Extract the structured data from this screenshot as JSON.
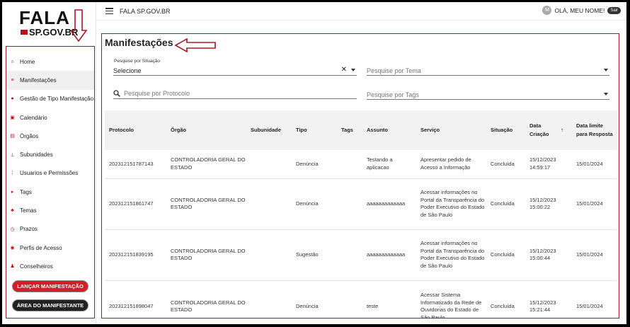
{
  "logo": {
    "fala": "FALA",
    "sub": "SP.GOV.BR"
  },
  "topbar": {
    "title": "FALA SP.GOV.BR",
    "avatar_initial": "M",
    "greeting": "OLÁ, MEU NOME!",
    "logout": "Sair"
  },
  "sidebar": {
    "items": [
      {
        "label": "Home",
        "icon": "home-icon"
      },
      {
        "label": "Manifestações",
        "icon": "list-icon"
      },
      {
        "label": "Gestão de Tipo Manifestação",
        "icon": "chat-icon"
      },
      {
        "label": "Calendário",
        "icon": "calendar-icon"
      },
      {
        "label": "Órgãos",
        "icon": "building-icon"
      },
      {
        "label": "Subunidades",
        "icon": "sitemap-icon"
      },
      {
        "label": "Usuarios e Permissões",
        "icon": "users-icon"
      },
      {
        "label": "Tags",
        "icon": "tag-icon"
      },
      {
        "label": "Temas",
        "icon": "theme-icon"
      },
      {
        "label": "Prazos",
        "icon": "clock-icon"
      },
      {
        "label": "Perfis de Acesso",
        "icon": "shield-icon"
      },
      {
        "label": "Conselheiros",
        "icon": "person-icon"
      }
    ],
    "primary_button": "LANÇAR MANIFESTAÇÃO",
    "secondary_button": "ÁREA DO MANIFESTANTE"
  },
  "main": {
    "title": "Manifestações",
    "filters": {
      "situacao_label": "Pesquise por Situação",
      "situacao_value": "Selecione",
      "tema_placeholder": "Pesquise por Tema",
      "protocolo_placeholder": "Pesquise por Protocolo",
      "tags_placeholder": "Pesquise por Tags"
    },
    "table": {
      "headers": [
        "Protocolo",
        "Órgão",
        "Subunidade",
        "Tipo",
        "Tags",
        "Assunto",
        "Serviço",
        "Situação",
        "Data Criação",
        "Data limite para Resposta"
      ],
      "rows": [
        {
          "protocolo": "202312151787143",
          "orgao": "CONTROLADORIA GERAL DO ESTADO",
          "subunidade": "",
          "tipo": "Denúncia",
          "tags": "",
          "assunto": "Testando a aplicacao",
          "servico": "Apresentar pedido de Acesso a Informação",
          "situacao": "Concluída",
          "criacao": "15/12/2023 14:59:17",
          "limite": "15/01/2024"
        },
        {
          "protocolo": "202312151861747",
          "orgao": "CONTROLADORIA GERAL DO ESTADO",
          "subunidade": "",
          "tipo": "Denúncia",
          "tags": "",
          "assunto": "aaaaaaaaaaaaa",
          "servico": "Acessar informações no Portal da Transparência do Poder Executivo do Estado de São Paulo",
          "situacao": "Concluída",
          "criacao": "15/12/2023 15:00:22",
          "limite": "15/01/2024"
        },
        {
          "protocolo": "202312151839195",
          "orgao": "CONTROLADORIA GERAL DO ESTADO",
          "subunidade": "",
          "tipo": "Sugestão",
          "tags": "",
          "assunto": "aaaaaaaaaaaaa",
          "servico": "Acessar informações no Portal da Transparência do Poder Executivo do Estado de São Paulo",
          "situacao": "Concluída",
          "criacao": "15/12/2023 15:00:44",
          "limite": "15/01/2024"
        },
        {
          "protocolo": "202312151898047",
          "orgao": "CONTROLADORIA GERAL DO ESTADO",
          "subunidade": "",
          "tipo": "Denúncia",
          "tags": "",
          "assunto": "teste",
          "servico": "Acessar Sistema Informatizado da Rede de Ouvidorias do Estado de São Paulo",
          "situacao": "Concluída",
          "criacao": "15/12/2023 15:21:44",
          "limite": "15/01/2024"
        }
      ]
    }
  },
  "colors": {
    "accent_red": "#b5121b",
    "button_red": "#d01f26",
    "dark": "#222222"
  }
}
